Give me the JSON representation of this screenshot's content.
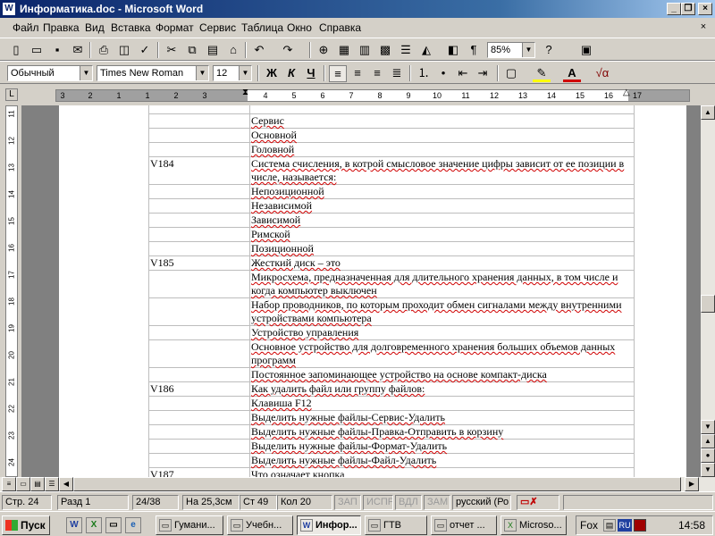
{
  "window": {
    "title": "Информатика.doc - Microsoft Word",
    "app_icon": "W"
  },
  "menu": [
    "Файл",
    "Правка",
    "Вид",
    "Вставка",
    "Формат",
    "Сервис",
    "Таблица",
    "Окно",
    "Справка"
  ],
  "toolbar": {
    "zoom": "85%",
    "style": "Обычный",
    "font": "Times New Roman",
    "size": "12",
    "bold": "Ж",
    "italic": "К",
    "underline": "Ч"
  },
  "ruler": {
    "h_numbers": [
      "3",
      "2",
      "1",
      "1",
      "2",
      "3",
      "4",
      "5",
      "6",
      "7",
      "8",
      "9",
      "10",
      "11",
      "12",
      "13",
      "14",
      "15",
      "16",
      "17"
    ],
    "v_numbers": [
      "11",
      "12",
      "13",
      "14",
      "15",
      "16",
      "17",
      "18",
      "19",
      "20",
      "21",
      "22",
      "23",
      "24"
    ]
  },
  "table": {
    "rows": [
      {
        "id": "",
        "text": "Сервис"
      },
      {
        "id": "",
        "text": "Основной"
      },
      {
        "id": "",
        "text": "Головной"
      },
      {
        "id": "V184",
        "text": "Система счисления, в котрой смысловое значение цифры зависит от ее позиции в числе, называется:"
      },
      {
        "id": "",
        "text": "Непозиционной"
      },
      {
        "id": "",
        "text": "Независимой"
      },
      {
        "id": "",
        "text": "Зависимой"
      },
      {
        "id": "",
        "text": "Римской"
      },
      {
        "id": "",
        "text": "Позиционной"
      },
      {
        "id": "V185",
        "text": "Жесткий диск – это"
      },
      {
        "id": "",
        "text": "Микросхема, предназначенная для длительного хранения данных, в том числе и когда компьютер выключен"
      },
      {
        "id": "",
        "text": "Набор проводников, по которым проходит обмен сигналами между внутренними устройствами компьютера"
      },
      {
        "id": "",
        "text": "Устройство управления"
      },
      {
        "id": "",
        "text": "Основное устройство для долговременного хранения больших объемов данных программ"
      },
      {
        "id": "",
        "text": "Постоянное запоминающее устройство на основе компакт-диска"
      },
      {
        "id": "V186",
        "text": "Как удалить файл или группу файлов:"
      },
      {
        "id": "",
        "text": "Клавиша F12"
      },
      {
        "id": "",
        "text": "Выделить нужные файлы-Сервис-Удалить"
      },
      {
        "id": "",
        "text": "Выделить нужные файлы-Правка-Отправить в корзину"
      },
      {
        "id": "",
        "text": "Выделить нужные файлы-Формат-Удалить"
      },
      {
        "id": "",
        "text": "Выделить нужные файлы-Файл-Удалить"
      },
      {
        "id": "V187",
        "text": "Что означает кнопка"
      }
    ]
  },
  "status": {
    "page": "Стр. 24",
    "section": "Разд 1",
    "pages": "24/38",
    "at": "На 25,3см",
    "line": "Ст 49",
    "col": "Кол 20",
    "rec": "ЗАП",
    "trk": "ИСПР",
    "ext": "ВДЛ",
    "ovr": "ЗАМ",
    "lang": "русский (Ро"
  },
  "taskbar": {
    "start": "Пуск",
    "tasks": [
      {
        "label": "Гумани...",
        "icon": "folder-icon",
        "active": false
      },
      {
        "label": "Учебн...",
        "icon": "folder-icon",
        "active": false
      },
      {
        "label": "Инфор...",
        "icon": "word-icon",
        "active": true
      },
      {
        "label": "ГТВ",
        "icon": "folder-icon",
        "active": false
      },
      {
        "label": "отчет ...",
        "icon": "folder-icon",
        "active": false
      },
      {
        "label": "Microso...",
        "icon": "excel-icon",
        "active": false
      }
    ],
    "tray_text": "Fox",
    "lang": "RU",
    "clock": "14:58"
  }
}
